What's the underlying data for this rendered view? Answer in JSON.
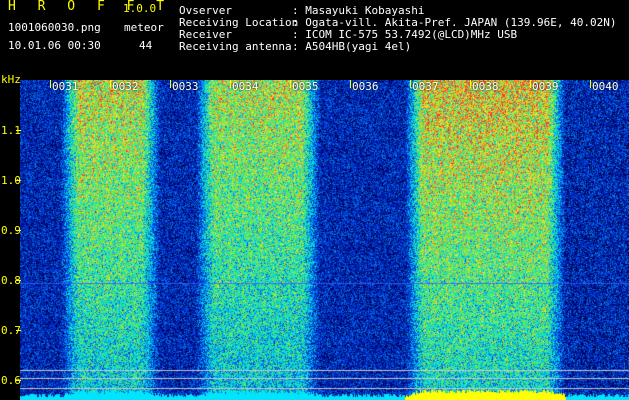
{
  "header": {
    "app_name": "H R O F F T",
    "version": "1.0.0",
    "filename": "1001060030.png",
    "meteor_label": "meteor",
    "datetime": "10.01.06 00:30",
    "meteor_count": "44",
    "labels": {
      "observer": "Ovserver",
      "location": "Receiving Location",
      "receiver": "Receiver",
      "antenna": "Receiving antenna"
    },
    "values": {
      "observer": ": Masayuki Kobayashi",
      "location": ": Ogata-vill. Akita-Pref. JAPAN (139.96E, 40.02N)",
      "receiver": ": ICOM IC-575 53.7492(@LCD)MHz USB",
      "antenna": ": A504HB(yagi 4el)"
    }
  },
  "y_axis": {
    "unit": "kHz",
    "ticks": [
      "1.1",
      "1.0",
      "0.9",
      "0.8",
      "0.7",
      "0.6"
    ]
  },
  "time_axis": {
    "labels": [
      "0031",
      "0032",
      "0033",
      "0034",
      "0035",
      "0036",
      "0037",
      "0038",
      "0039",
      "0040"
    ]
  },
  "colors": {
    "text_yellow": "#ffff00",
    "text_white": "#ffffff",
    "background": "#000000"
  }
}
